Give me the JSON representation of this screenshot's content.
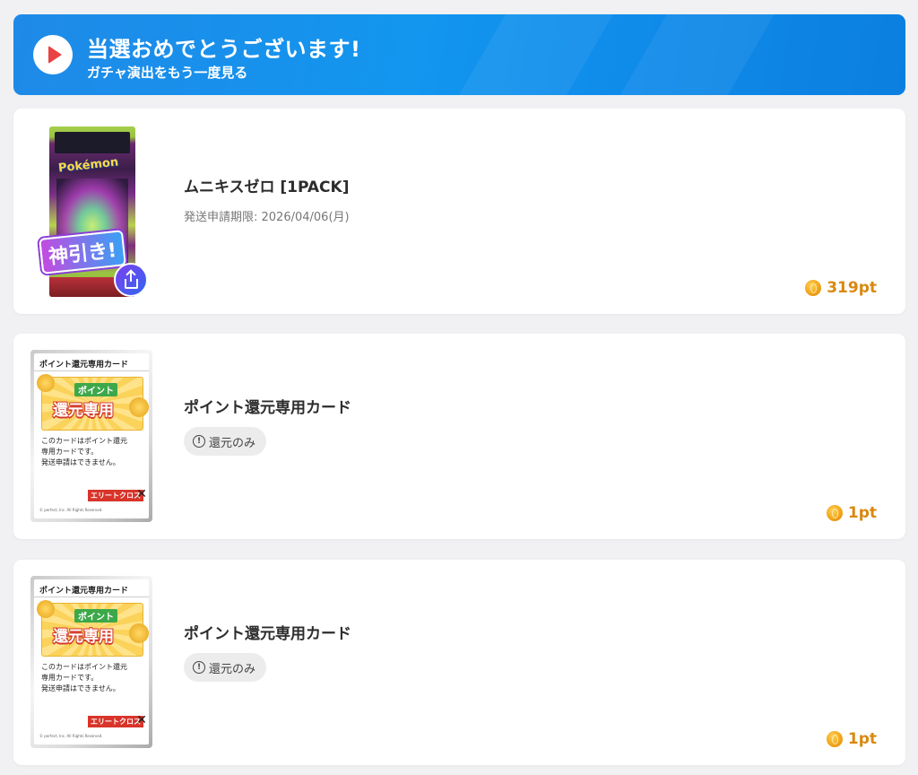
{
  "banner": {
    "title": "当選おめでとうございます!",
    "subtitle": "ガチャ演出をもう一度見る"
  },
  "items": [
    {
      "name": "ムニキスゼロ [1PACK]",
      "deadline": "発送申請期限: 2026/04/06(月)",
      "badge_label": "神引き!",
      "pack_logo": "Pokémon",
      "points": "319pt"
    },
    {
      "name": "ポイント還元専用カード",
      "tag": "還元のみ",
      "points": "1pt",
      "card": {
        "header": "ポイント還元専用カード",
        "gold_small": "ポイント",
        "gold_big": "還元専用",
        "text": [
          "このカードはポイント還元",
          "専用カードです。",
          "発送申請はできません。"
        ],
        "copyright": "© perfect, Inc. All Rights Reserved."
      }
    },
    {
      "name": "ポイント還元専用カード",
      "tag": "還元のみ",
      "points": "1pt",
      "card": {
        "header": "ポイント還元専用カード",
        "gold_small": "ポイント",
        "gold_big": "還元専用",
        "text": [
          "このカードはポイント還元",
          "専用カードです。",
          "発送申請はできません。"
        ],
        "copyright": "© perfect, Inc. All Rights Reserved."
      }
    }
  ]
}
